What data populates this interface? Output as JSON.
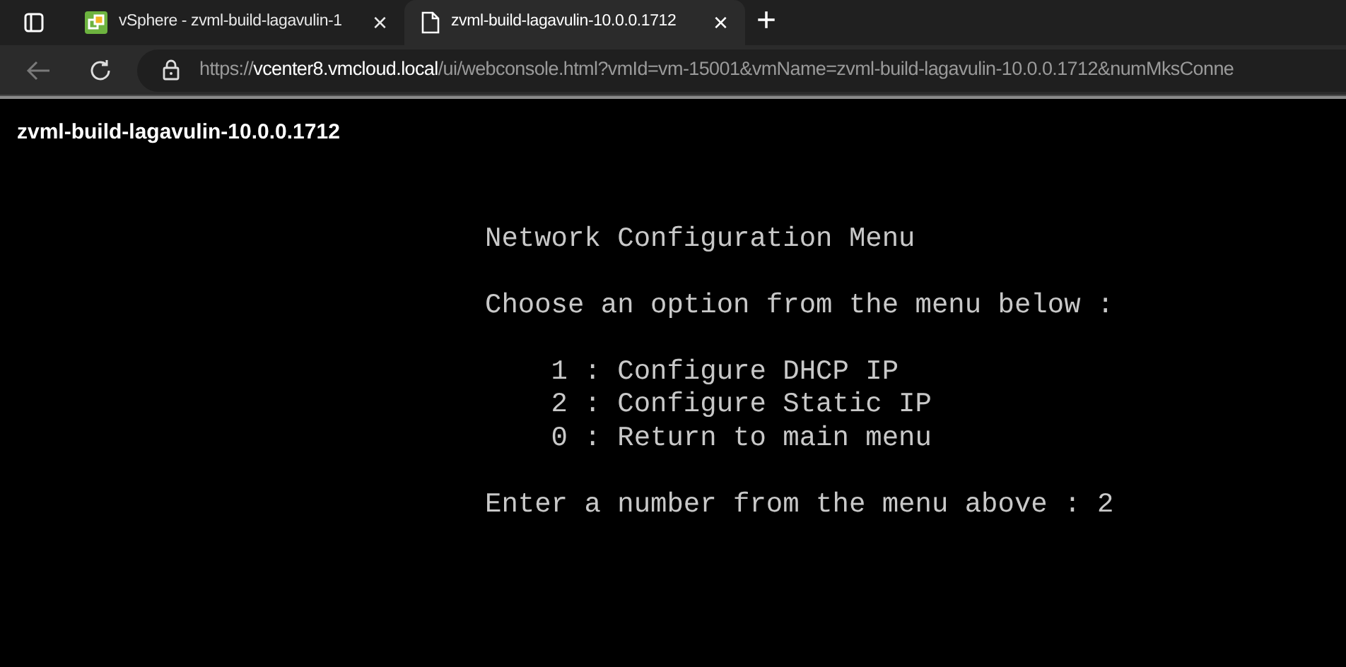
{
  "tabs": [
    {
      "title": "vSphere - zvml-build-lagavulin-1",
      "kind": "vsphere",
      "selected": false,
      "close": "×"
    },
    {
      "title": "zvml-build-lagavulin-10.0.0.1712",
      "kind": "page",
      "selected": true,
      "close": "×"
    }
  ],
  "new_tab": "+",
  "address_bar": {
    "scheme": "https://",
    "host": "vcenter8.vmcloud.local",
    "path": "/ui/webconsole.html?vmId=vm-15001&vmName=zvml-build-lagavulin-10.0.0.1712&numMksConne"
  },
  "console_title": "zvml-build-lagavulin-10.0.0.1712",
  "terminal": {
    "heading": "Network Configuration Menu",
    "instruction": "Choose an option from the menu below :",
    "options": [
      {
        "key": "1",
        "separator": ":",
        "label": "Configure DHCP IP"
      },
      {
        "key": "2",
        "separator": ":",
        "label": "Configure Static IP"
      },
      {
        "key": "0",
        "separator": ":",
        "label": "Return to main menu"
      }
    ],
    "prompt": "Enter a number from the menu above :",
    "input": "2"
  }
}
